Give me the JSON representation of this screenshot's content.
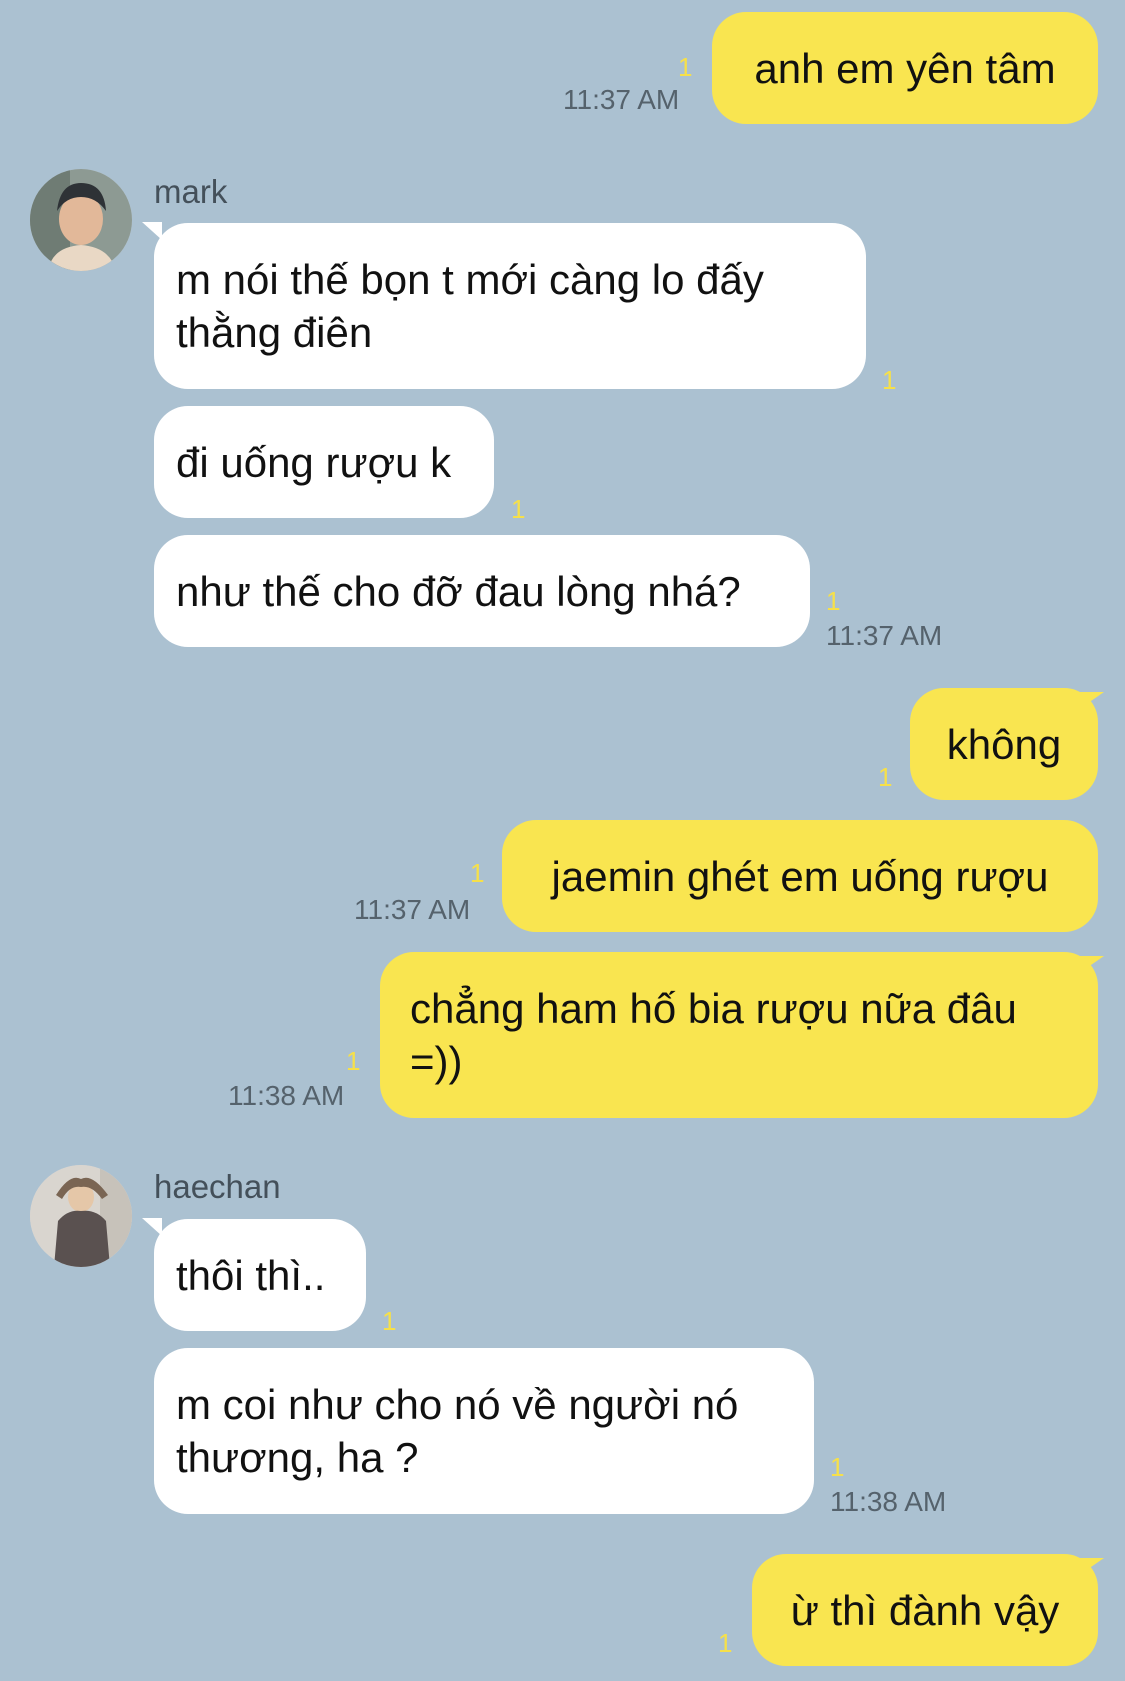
{
  "messages": {
    "m1": {
      "text": "anh em yên tâm",
      "read": "1",
      "time": "11:37 AM"
    },
    "m2": {
      "sender": "mark",
      "text": " m nói thế bọn t mới càng lo đấy thằng điên",
      "read": "1"
    },
    "m3": {
      "text": "đi uống rượu k",
      "read": "1"
    },
    "m4": {
      "text": "như thế cho đỡ đau lòng nhá?",
      "read": "1",
      "time": "11:37 AM"
    },
    "m5": {
      "text": "không",
      "read": "1"
    },
    "m6": {
      "text": "jaemin ghét em uống rượu",
      "read": "1",
      "time": "11:37 AM"
    },
    "m7": {
      "text": "chẳng ham hố bia rượu nữa đâu =))",
      "read": "1",
      "time": "11:38 AM"
    },
    "m8": {
      "sender": "haechan",
      "text": "thôi thì..",
      "read": "1"
    },
    "m9": {
      "text": "m coi như cho nó về người nó thương, ha ?",
      "read": "1",
      "time": "11:38 AM"
    },
    "m10": {
      "text": "ừ thì đành vậy",
      "read": "1"
    }
  },
  "colors": {
    "background": "#abc1d1",
    "outgoing_bubble": "#f9e550",
    "incoming_bubble": "#ffffff",
    "read_count": "#f6e04a"
  }
}
